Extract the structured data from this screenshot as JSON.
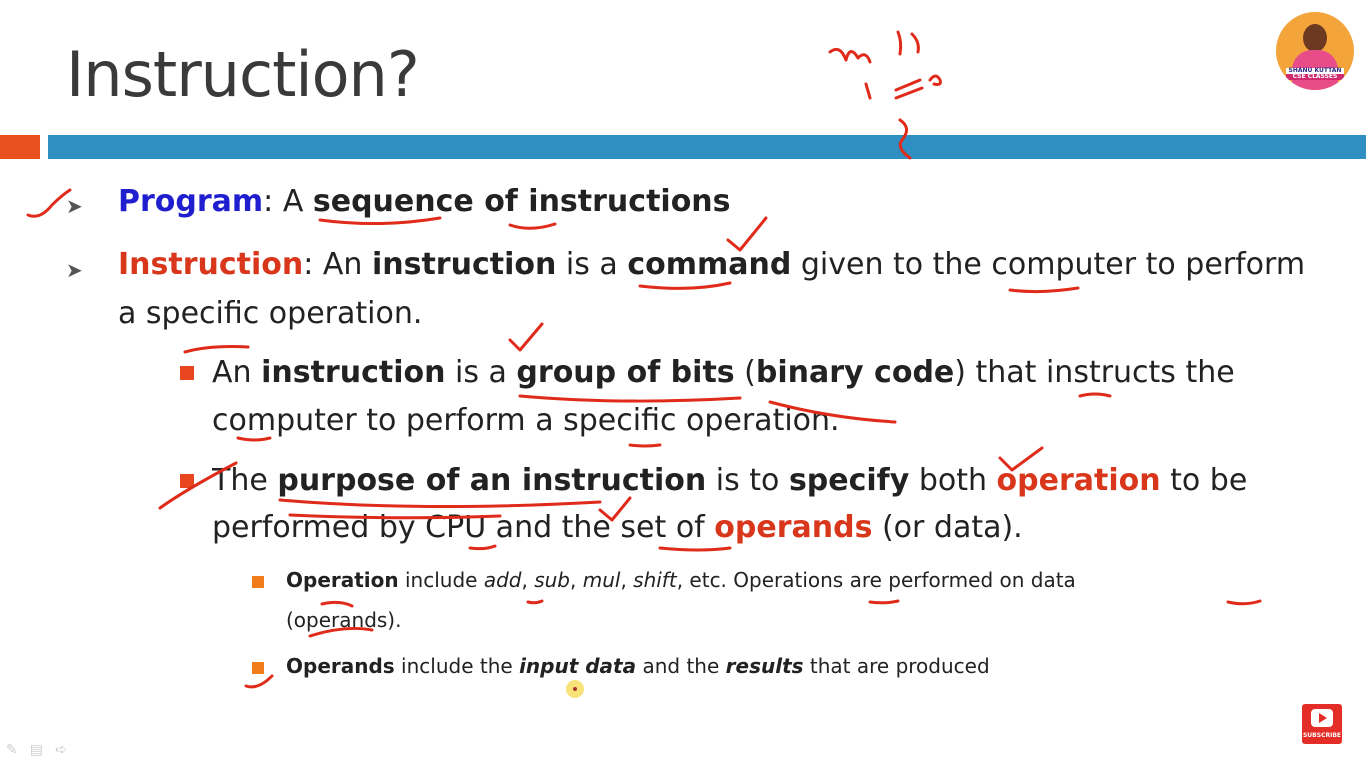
{
  "slide": {
    "title": "Instruction?",
    "line1": {
      "keyword": "Program",
      "colon": ": A ",
      "b1": "sequence of instructions"
    },
    "line2": {
      "keyword": "Instruction",
      "colon": ": An ",
      "b1": "instruction",
      "t1": " is a ",
      "b2": "command",
      "t2": " given to the computer to perform",
      "cont": "a specific operation."
    },
    "bullet1": {
      "t0": "An ",
      "b1": "instruction",
      "t1": " is a ",
      "b2": "group of bits",
      "t2": " (",
      "b3": "binary code",
      "t3": ") that instructs the",
      "cont": "computer to perform a specific operation."
    },
    "bullet2": {
      "t0": "The ",
      "b1": "purpose of an instruction",
      "t1": " is to ",
      "b2": "specify",
      "t2": " both ",
      "r1": "operation",
      "t3": " to be",
      "c0": "performed by CPU and the set of ",
      "r2": "operands",
      "c1": " (or data)."
    },
    "sub1": {
      "b1": "Operation",
      "t1": " include ",
      "i1": "add",
      "t2": ", ",
      "i2": "sub",
      "t3": ", ",
      "i3": "mul",
      "t4": ", ",
      "i4": "shift",
      "t5": ", etc. Operations are performed on data",
      "cont": "(operands)."
    },
    "sub2": {
      "b1": "Operands",
      "t1": " include the ",
      "bi1": "input data",
      "t2": " and the ",
      "bi2": "results",
      "t3": " that are produced"
    }
  },
  "channel": {
    "badge_line1": "SHANU KUTTAN",
    "badge_line2": "CSE CLASSES"
  },
  "subscribe_label": "SUBSCRIBE",
  "colors": {
    "blue_keyword": "#1f1fd0",
    "red_keyword": "#d9371c",
    "accent_bar": "#2e8fc0",
    "bullet": "#e8461e",
    "ink": "#e02a1a"
  }
}
